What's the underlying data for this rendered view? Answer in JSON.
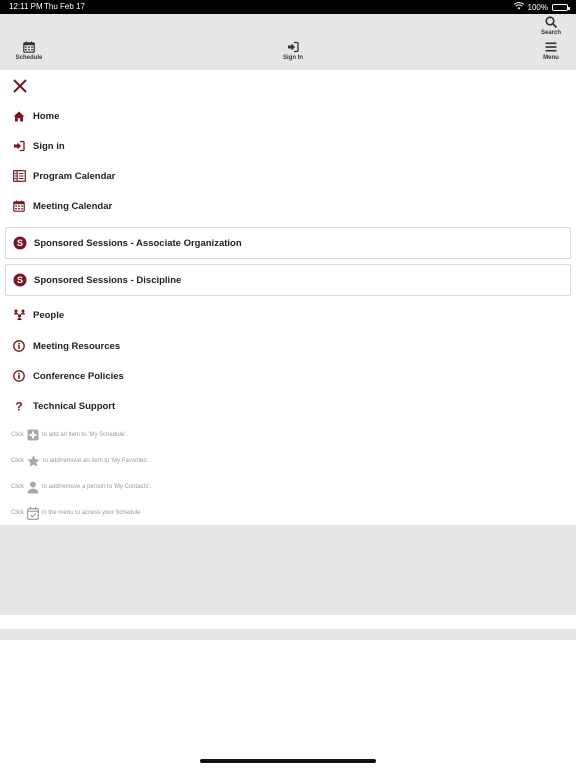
{
  "status_bar": {
    "time": "12:11 PM",
    "date": "Thu Feb 17",
    "battery": "100%"
  },
  "toolbar": {
    "schedule_label": "Schedule",
    "signin_label": "Sign In",
    "search_label": "Search",
    "menu_label": "Menu"
  },
  "menu": {
    "home": "Home",
    "signin": "Sign in",
    "program_calendar": "Program Calendar",
    "meeting_calendar": "Meeting Calendar",
    "sponsored_assoc": "Sponsored Sessions - Associate Organization",
    "sponsored_discipline": "Sponsored Sessions - Discipline",
    "people": "People",
    "meeting_resources": "Meeting Resources",
    "conference_policies": "Conference Policies",
    "technical_support": "Technical Support"
  },
  "hints": {
    "schedule_pre": "Click",
    "schedule_post": "to add an item to 'My Schedule'.",
    "favorites_pre": "Click",
    "favorites_post": "to add/remove an item to 'My Favorites'.",
    "contacts_pre": "Click",
    "contacts_post": "to add/remove a person to 'My Contacts'.",
    "menu_pre": "Click",
    "menu_post": "in the menu to access your Schedule"
  },
  "colors": {
    "accent": "#7a1620",
    "toolbar_bg": "#e6e6e6"
  }
}
